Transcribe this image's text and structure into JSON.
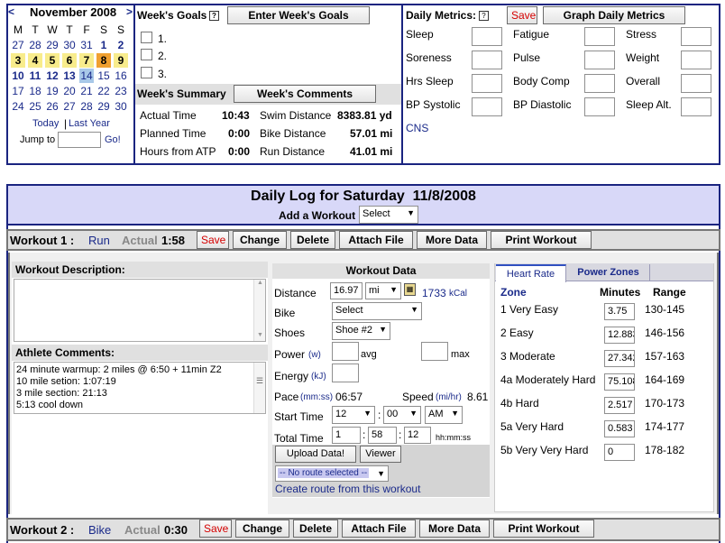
{
  "calendar": {
    "prev": "<",
    "next": ">",
    "month": "November 2008",
    "weekdays": [
      "M",
      "T",
      "W",
      "T",
      "F",
      "S",
      "S"
    ],
    "weeks": [
      [
        "27",
        "28",
        "29",
        "30",
        "31",
        "1",
        "2"
      ],
      [
        "3",
        "4",
        "5",
        "6",
        "7",
        "8",
        "9"
      ],
      [
        "10",
        "11",
        "12",
        "13",
        "14",
        "15",
        "16"
      ],
      [
        "17",
        "18",
        "19",
        "20",
        "21",
        "22",
        "23"
      ],
      [
        "24",
        "25",
        "26",
        "27",
        "28",
        "29",
        "30"
      ]
    ],
    "today_link": "Today",
    "last_year_link": "Last Year",
    "jump_label": "Jump to",
    "go_label": "Go!"
  },
  "goals": {
    "title": "Week's Goals",
    "enter_button": "Enter Week's Goals",
    "items": [
      "1.",
      "2.",
      "3."
    ]
  },
  "summary": {
    "title": "Week's Summary",
    "comments_button": "Week's Comments",
    "rows": [
      {
        "label": "Actual Time",
        "value": "10:43",
        "label2": "Swim Distance",
        "value2": "8383.81 yd"
      },
      {
        "label": "Planned Time",
        "value": "0:00",
        "label2": "Bike Distance",
        "value2": "57.01 mi"
      },
      {
        "label": "Hours from ATP",
        "value": "0:00",
        "label2": "Run Distance",
        "value2": "41.01 mi"
      }
    ]
  },
  "metrics": {
    "title": "Daily Metrics:",
    "save": "Save",
    "graph_button": "Graph Daily Metrics",
    "rows": [
      [
        "Sleep",
        "Fatigue",
        "Stress"
      ],
      [
        "Soreness",
        "Pulse",
        "Weight"
      ],
      [
        "Hrs Sleep",
        "Body Comp",
        "Overall"
      ],
      [
        "BP Systolic",
        "BP Diastolic",
        "Sleep Alt."
      ]
    ],
    "cns": "CNS"
  },
  "daily_log": {
    "title": "Daily Log for Saturday  11/8/2008",
    "add_label": "Add a Workout",
    "add_select": "Select"
  },
  "workout1": {
    "label": "Workout 1 :",
    "sport": "Run",
    "actual_label": "Actual",
    "actual": "1:58",
    "buttons": [
      "Save",
      "Change",
      "Delete",
      "Attach File",
      "More Data",
      "Print Workout"
    ]
  },
  "workout2": {
    "label": "Workout 2 :",
    "sport": "Bike",
    "actual_label": "Actual",
    "actual": "0:30",
    "buttons": [
      "Save",
      "Change",
      "Delete",
      "Attach File",
      "More Data",
      "Print Workout"
    ]
  },
  "description": {
    "title": "Workout Description:"
  },
  "comments": {
    "title": "Athlete Comments:",
    "lines": [
      "24 minute warmup: 2 miles @ 6:50 + 11min Z2",
      "10 mile setion: 1:07:19",
      "3 mile section: 21:13",
      "5:13 cool down"
    ]
  },
  "workout_data": {
    "title": "Workout Data",
    "distance_label": "Distance",
    "distance": "16.97",
    "distance_unit": "mi",
    "kcal": "1733",
    "kcal_unit": "kCal",
    "bike_label": "Bike",
    "bike_select": "Select",
    "shoes_label": "Shoes",
    "shoes_select": "Shoe #2",
    "power_label": "Power",
    "power_unit": "(w)",
    "avg": "avg",
    "max": "max",
    "energy_label": "Energy",
    "energy_unit": "(kJ)",
    "pace_label": "Pace",
    "pace_unit": "(mm:ss)",
    "pace": "06:57",
    "speed_label": "Speed",
    "speed_unit": "(mi/hr)",
    "speed": "8.61",
    "start_label": "Start Time",
    "start_h": "12",
    "start_m": "00",
    "start_ampm": "AM",
    "total_label": "Total Time",
    "total_h": "1",
    "total_m": "58",
    "total_s": "12",
    "total_fmt": "hh:mm:ss",
    "upload": "Upload Data!",
    "viewer": "Viewer",
    "route_select": "-- No route selected --",
    "route_link": "Create route from this workout"
  },
  "zones": {
    "tabs": [
      "Heart Rate",
      "Power Zones"
    ],
    "headers": [
      "Zone",
      "Minutes",
      "Range"
    ],
    "rows": [
      {
        "zone": "1 Very Easy",
        "minutes": "3.75",
        "range": "130-145"
      },
      {
        "zone": "2 Easy",
        "minutes": "12.883",
        "range": "146-156"
      },
      {
        "zone": "3 Moderate",
        "minutes": "27.342",
        "range": "157-163"
      },
      {
        "zone": "4a Moderately Hard",
        "minutes": "75.108",
        "range": "164-169"
      },
      {
        "zone": "4b Hard",
        "minutes": "2.517",
        "range": "170-173"
      },
      {
        "zone": "5a Very Hard",
        "minutes": "0.583",
        "range": "174-177"
      },
      {
        "zone": "5b Very Very Hard",
        "minutes": "0",
        "range": "178-182"
      }
    ]
  }
}
